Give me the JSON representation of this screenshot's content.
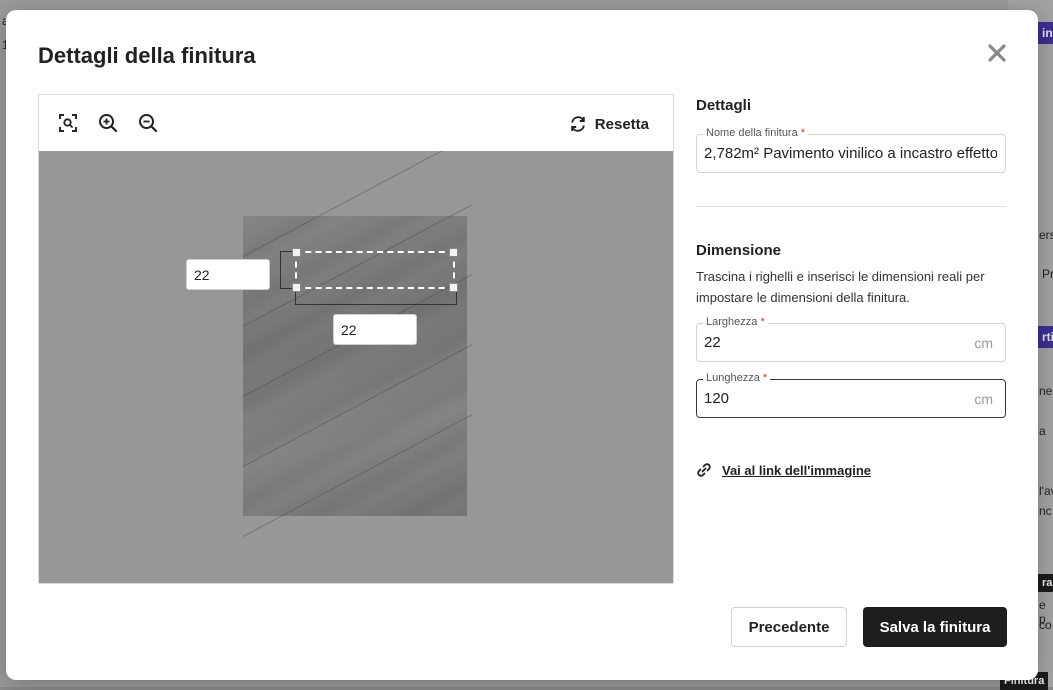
{
  "background": {
    "fragments": [
      "in",
      "ers",
      "Pr",
      "rti",
      "ne",
      "a",
      "l'av",
      "nc",
      "ra",
      "e p",
      "co",
      "Finitura",
      "a",
      "1"
    ]
  },
  "modal": {
    "title": "Dettagli della finitura",
    "close_icon": "close-icon"
  },
  "editor": {
    "tools": [
      "fit-screen-icon",
      "zoom-in-icon",
      "zoom-out-icon"
    ],
    "reset_label": "Resetta",
    "width_measure": "22",
    "height_measure": "22"
  },
  "details": {
    "section_title": "Dettagli",
    "name_label": "Nome della finitura",
    "name_value": "2,782m² Pavimento vinilico a incastro effetto legno",
    "required_mark": "*"
  },
  "dimension": {
    "section_title": "Dimensione",
    "help_text": "Trascina i righelli e inserisci le dimensioni reali per impostare le dimensioni della finitura.",
    "width_label": "Larghezza",
    "width_value": "22",
    "length_label": "Lunghezza",
    "length_value": "120",
    "unit": "cm"
  },
  "link": {
    "label": "Vai al link dell'immagine"
  },
  "footer": {
    "previous_label": "Precedente",
    "save_label": "Salva la finitura"
  },
  "colors": {
    "primary_button": "#1e1e1e",
    "required": "#c0392b",
    "background_accent": "#3b2f8f"
  }
}
